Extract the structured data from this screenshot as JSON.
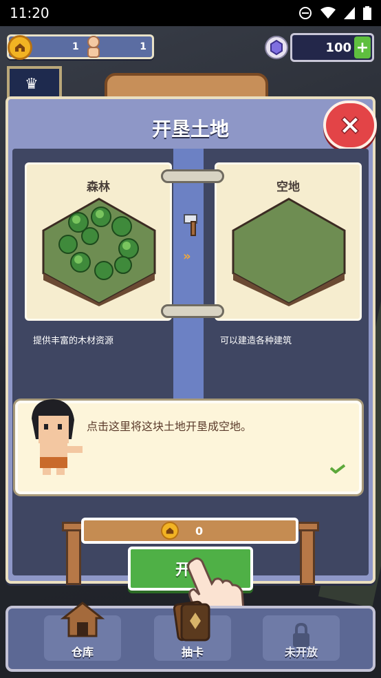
{
  "status": {
    "time": "11:20"
  },
  "resources": {
    "coins": "1",
    "villagers": "1",
    "gems": "100",
    "gem_plus": "+"
  },
  "modal": {
    "title": "开垦土地",
    "from_card": {
      "title": "森林",
      "description": "提供丰富的木材资源"
    },
    "to_card": {
      "title": "空地",
      "description": "可以建造各种建筑"
    },
    "dialog_text": "点击这里将这块土地开垦成空地。",
    "cost": "0",
    "develop_button": "开垦"
  },
  "nav": [
    {
      "label": "仓库",
      "icon": "warehouse-icon"
    },
    {
      "label": "抽卡",
      "icon": "card-draw-icon"
    },
    {
      "label": "未开放",
      "icon": "lock-icon"
    }
  ],
  "colors": {
    "modal_bg": "#8e97c7",
    "close_red": "#e34447",
    "develop_green": "#4fb046",
    "coin_gold": "#f2b323"
  }
}
